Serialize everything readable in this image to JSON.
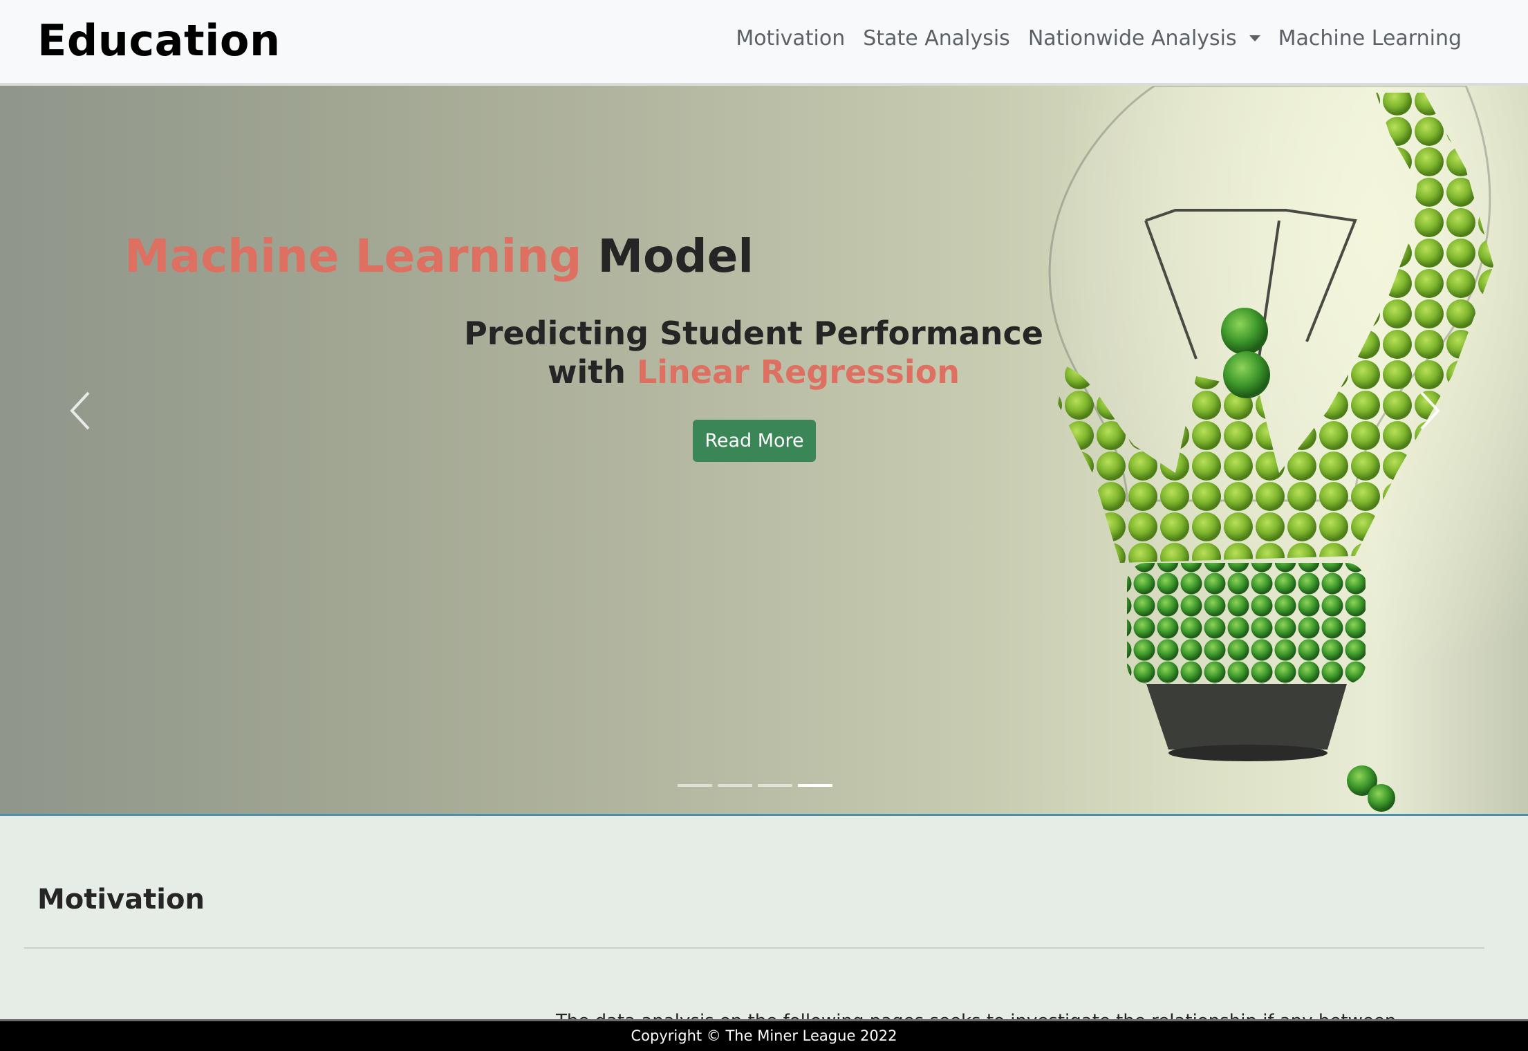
{
  "navbar": {
    "brand": "Education",
    "links": [
      {
        "label": "Motivation"
      },
      {
        "label": "State Analysis"
      },
      {
        "label": "Nationwide Analysis"
      },
      {
        "label": "Machine Learning"
      }
    ]
  },
  "hero": {
    "title_accent": "Machine Learning",
    "title_rest": " Model",
    "subtitle_line1": "Predicting Student Performance",
    "subtitle_with": "with ",
    "subtitle_accent": "Linear Regression",
    "button_label": "Read More",
    "slides_count": 4,
    "active_slide": 4,
    "accent_color": "#dd7060",
    "button_color": "#3b8657"
  },
  "motivation": {
    "title": "Motivation",
    "partial_text": "The data analysis on the following pages seeks to investigate the relationship if any between"
  },
  "footer": {
    "text": "Copyright © The Miner League 2022"
  }
}
